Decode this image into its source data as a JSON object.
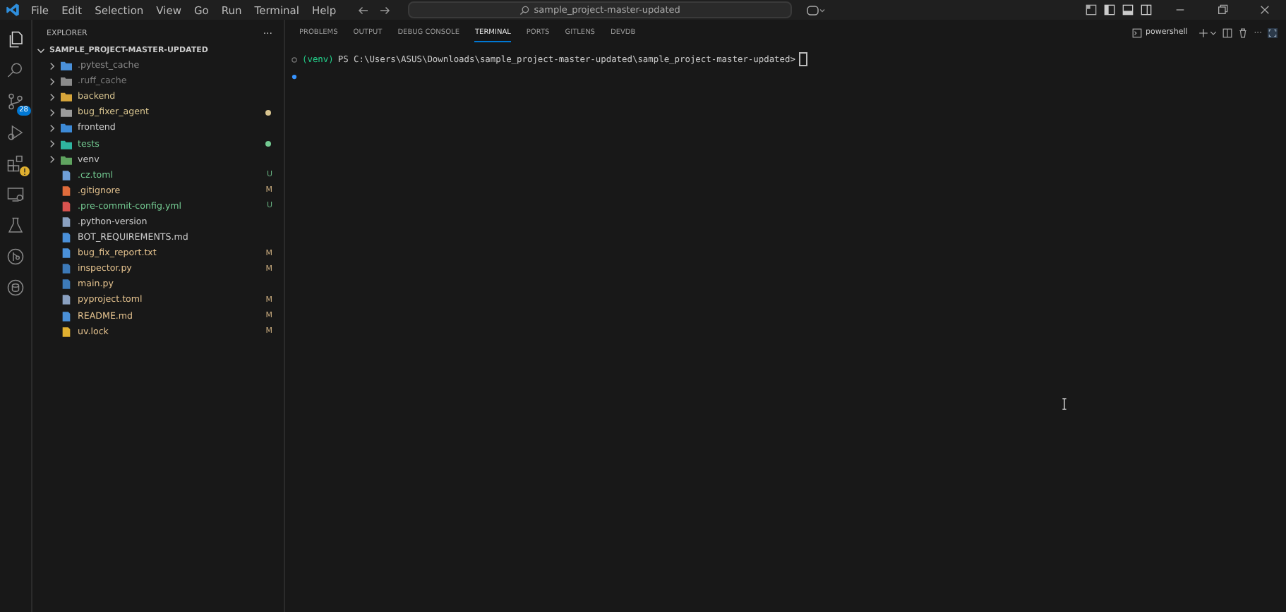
{
  "menu": [
    "File",
    "Edit",
    "Selection",
    "View",
    "Go",
    "Run",
    "Terminal",
    "Help"
  ],
  "command_center": {
    "text": "sample_project-master-updated"
  },
  "activity_bar": {
    "source_control_badge": "28"
  },
  "explorer": {
    "title": "EXPLORER",
    "more": "···",
    "root": "SAMPLE_PROJECT-MASTER-UPDATED",
    "root_expanded": true,
    "items": [
      {
        "kind": "folder",
        "name": ".pytest_cache",
        "color": "#8b8b8b"
      },
      {
        "kind": "folder",
        "name": ".ruff_cache",
        "color": "#7a7a7a"
      },
      {
        "kind": "folder",
        "name": "backend",
        "color": "#d8c48f"
      },
      {
        "kind": "folder",
        "name": "bug_fixer_agent",
        "color": "#d8c48f",
        "dot": true
      },
      {
        "kind": "folder",
        "name": "frontend",
        "color": "#cccccc"
      },
      {
        "kind": "folder",
        "name": "tests",
        "color": "#73c991",
        "dot": true
      },
      {
        "kind": "folder",
        "name": "venv",
        "color": "#cccccc"
      },
      {
        "kind": "file",
        "name": ".cz.toml",
        "color": "#73c991",
        "badge": "U"
      },
      {
        "kind": "file",
        "name": ".gitignore",
        "color": "#e2c08d",
        "badge": "M"
      },
      {
        "kind": "file",
        "name": ".pre-commit-config.yml",
        "color": "#73c991",
        "badge": "U"
      },
      {
        "kind": "file",
        "name": ".python-version",
        "color": "#cccccc"
      },
      {
        "kind": "file",
        "name": "BOT_REQUIREMENTS.md",
        "color": "#cccccc"
      },
      {
        "kind": "file",
        "name": "bug_fix_report.txt",
        "color": "#e2c08d",
        "badge": "M"
      },
      {
        "kind": "file",
        "name": "inspector.py",
        "color": "#e2c08d",
        "badge": "M"
      },
      {
        "kind": "file",
        "name": "main.py",
        "color": "#e2c08d"
      },
      {
        "kind": "file",
        "name": "pyproject.toml",
        "color": "#e2c08d",
        "badge": "M"
      },
      {
        "kind": "file",
        "name": "README.md",
        "color": "#e2c08d",
        "badge": "M"
      },
      {
        "kind": "file",
        "name": "uv.lock",
        "color": "#e2c08d",
        "badge": "M"
      }
    ]
  },
  "panel": {
    "tabs": [
      {
        "label": "PROBLEMS",
        "selected": false
      },
      {
        "label": "OUTPUT",
        "selected": false
      },
      {
        "label": "DEBUG CONSOLE",
        "selected": false
      },
      {
        "label": "TERMINAL",
        "selected": true
      },
      {
        "label": "PORTS",
        "selected": false
      },
      {
        "label": "GITLENS",
        "selected": false
      },
      {
        "label": "DEVDB",
        "selected": false
      }
    ],
    "shell": "powershell",
    "more": "···",
    "terminal": {
      "env": "(venv)",
      "prompt": "PS C:\\Users\\ASUS\\Downloads\\sample_project-master-updated\\sample_project-master-updated>"
    }
  }
}
